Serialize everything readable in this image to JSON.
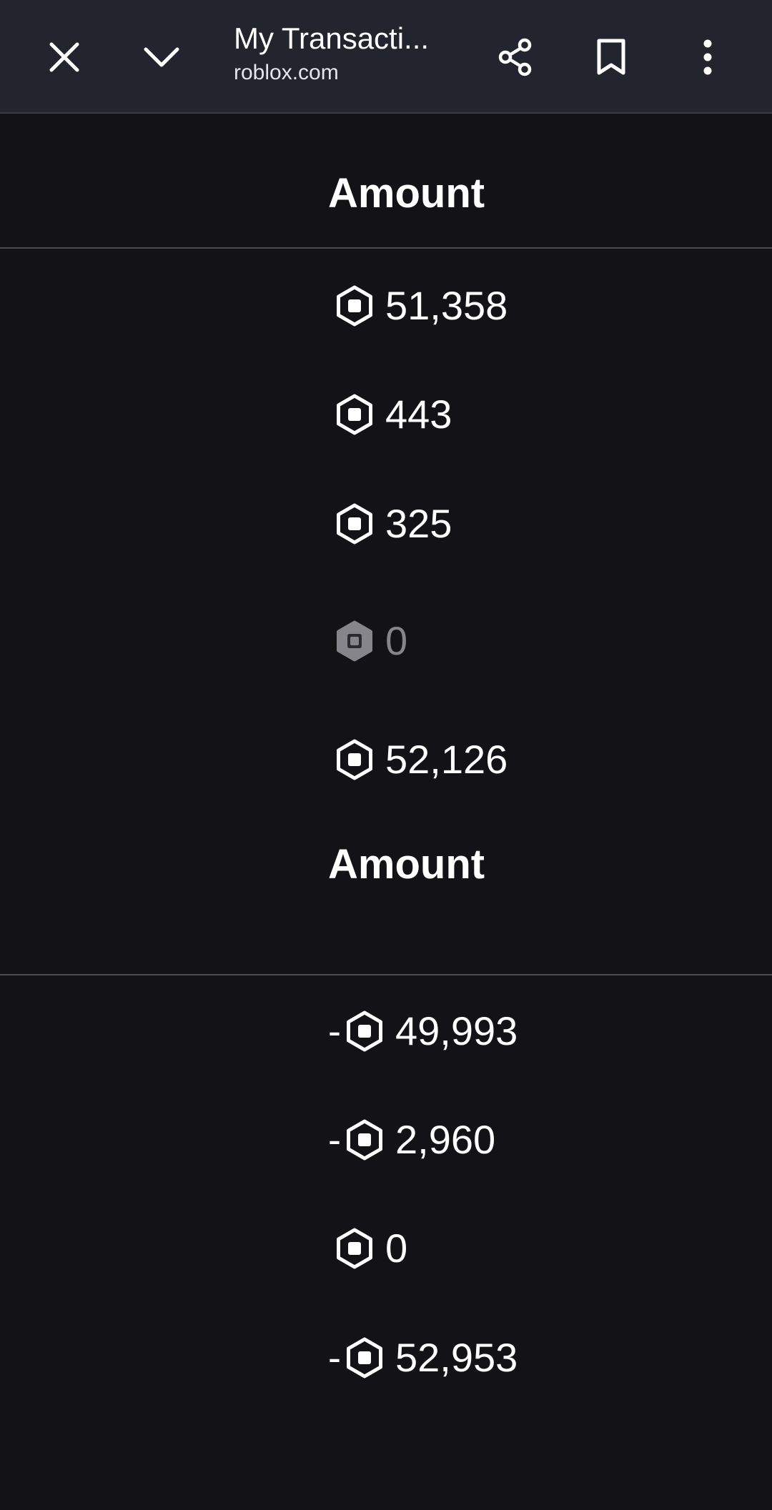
{
  "browser": {
    "title": "My Transacti...",
    "domain": "roblox.com",
    "icons": {
      "close": "close-icon",
      "collapse": "chevron-down-icon",
      "share": "share-icon",
      "bookmark": "bookmark-icon",
      "menu": "more-vertical-icon"
    }
  },
  "colors": {
    "background": "#131317",
    "toolbar": "#22252d",
    "text": "#ffffff",
    "muted": "#85858b"
  },
  "incoming": {
    "header": "Amount",
    "rows": [
      {
        "sign": "",
        "value": "51,358"
      },
      {
        "sign": "",
        "value": "443"
      },
      {
        "sign": "",
        "value": "325"
      },
      {
        "sign": "",
        "value": "0"
      },
      {
        "sign": "",
        "value": "52,126"
      }
    ]
  },
  "outgoing": {
    "header": "Amount",
    "rows": [
      {
        "sign": "-",
        "value": "49,993"
      },
      {
        "sign": "-",
        "value": "2,960"
      },
      {
        "sign": "",
        "value": "0"
      },
      {
        "sign": "-",
        "value": "52,953"
      }
    ]
  }
}
